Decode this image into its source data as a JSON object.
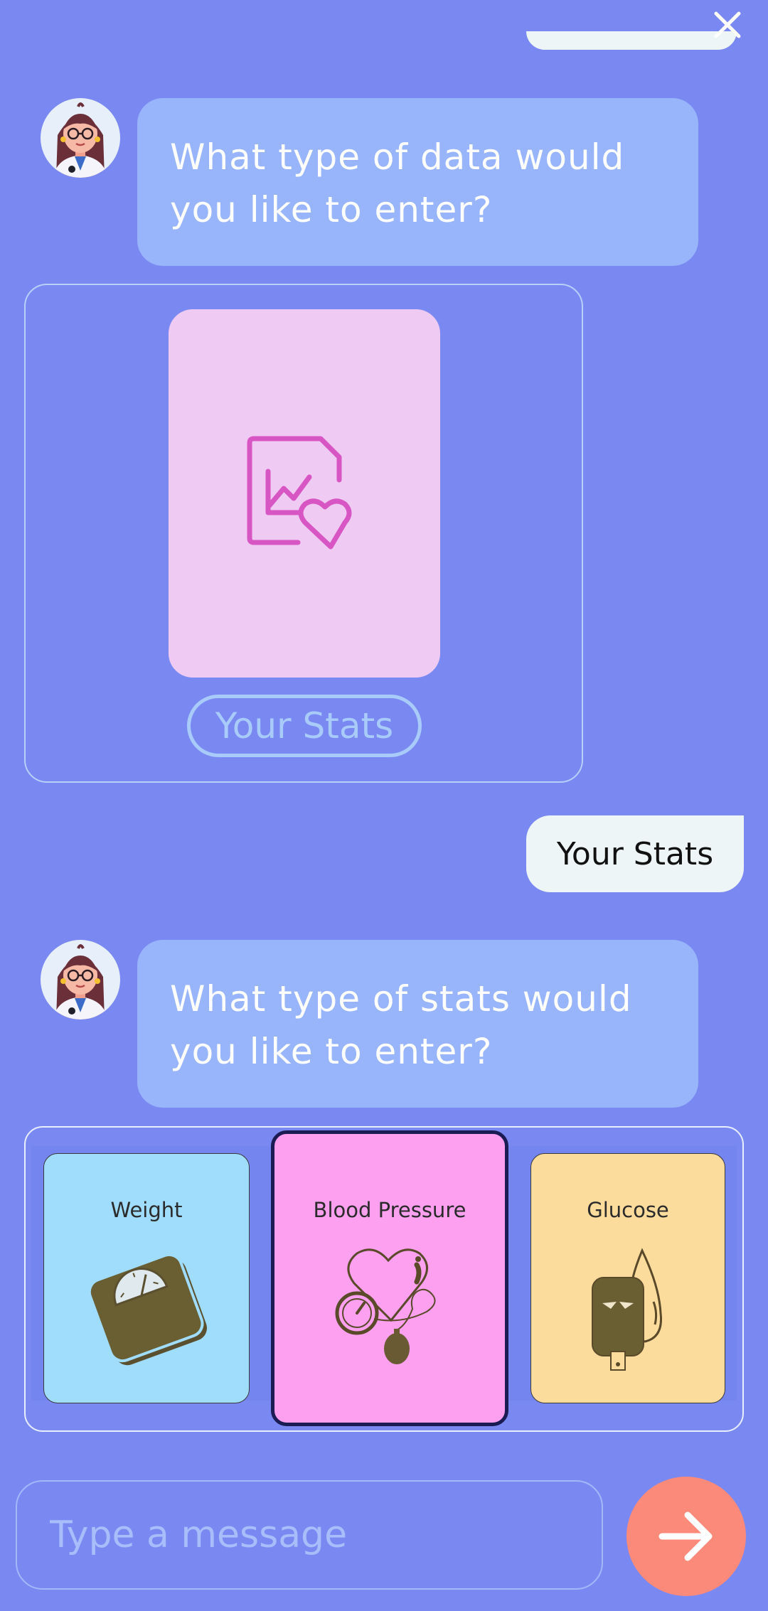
{
  "colors": {
    "background": "#7a89f2",
    "bot_bubble": "#98b4fb",
    "user_bubble": "#eef5f6",
    "stats_card": "#efcaf3",
    "weight_card": "#a0dcfc",
    "blood_pressure_card": "#fda0f0",
    "glucose_card": "#fbdc9c",
    "send_button": "#fc8a7b"
  },
  "header": {
    "close_icon": "close-icon"
  },
  "chat": {
    "message_1": "What type of data would you like to enter?",
    "stats_card": {
      "icon": "chart-heart-document-icon",
      "label": "Your Stats"
    },
    "user_reply": "Your Stats",
    "message_2": "What type of stats would you like to enter?",
    "options": [
      {
        "label": "Weight",
        "icon": "scale-icon"
      },
      {
        "label": "Blood Pressure",
        "icon": "blood-pressure-heart-icon",
        "selected": true
      },
      {
        "label": "Glucose",
        "icon": "glucose-meter-icon"
      }
    ]
  },
  "composer": {
    "placeholder": "Type a message",
    "send_icon": "arrow-right-icon"
  }
}
